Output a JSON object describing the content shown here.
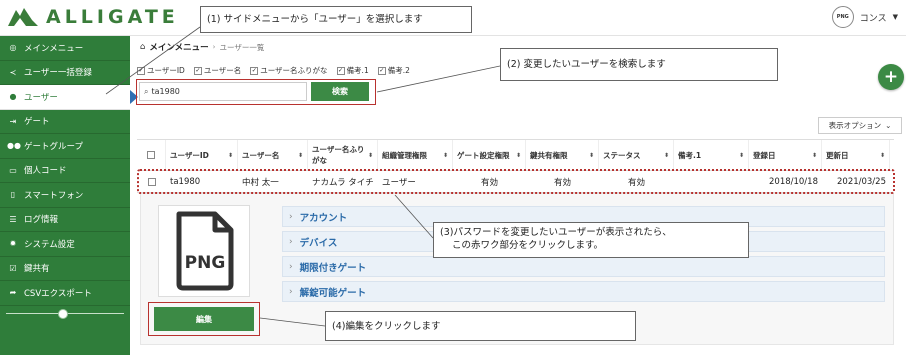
{
  "header": {
    "logo_text": "ALLIGATE",
    "avatar_text": "PNG",
    "user_name": "コンス",
    "user_caret": "▼"
  },
  "sidebar": {
    "items": [
      {
        "icon": "dashboard-icon",
        "glyph": "◎",
        "label": "メインメニュー"
      },
      {
        "icon": "share-icon",
        "glyph": "≺",
        "label": "ユーザー一括登録"
      },
      {
        "icon": "user-icon",
        "glyph": "●",
        "label": "ユーザー"
      },
      {
        "icon": "sign-in-icon",
        "glyph": "⇥",
        "label": "ゲート"
      },
      {
        "icon": "users-icon",
        "glyph": "●●",
        "label": "ゲートグループ"
      },
      {
        "icon": "card-icon",
        "glyph": "▭",
        "label": "個人コード"
      },
      {
        "icon": "phone-icon",
        "glyph": "▯",
        "label": "スマートフォン"
      },
      {
        "icon": "list-icon",
        "glyph": "☰",
        "label": "ログ情報"
      },
      {
        "icon": "gear-icon",
        "glyph": "✹",
        "label": "システム設定"
      },
      {
        "icon": "check-icon",
        "glyph": "☑",
        "label": "鍵共有"
      },
      {
        "icon": "export-icon",
        "glyph": "➦",
        "label": "CSVエクスポート"
      }
    ],
    "active_index": 2
  },
  "breadcrumb": {
    "home": "メインメニュー",
    "current": "ユーザー一覧"
  },
  "column_toggles": [
    {
      "label": "ユーザーID",
      "checked": true
    },
    {
      "label": "ユーザー名",
      "checked": true
    },
    {
      "label": "ユーザー名ふりがな",
      "checked": true
    },
    {
      "label": "備考.1",
      "checked": true
    },
    {
      "label": "備考.2",
      "checked": true
    }
  ],
  "search": {
    "value": "ta1980",
    "button_label": "検索"
  },
  "add_button": "+",
  "display_options": {
    "label": "表示オプション",
    "chevron": "⌄"
  },
  "table": {
    "headers": [
      "ユーザーID",
      "ユーザー名",
      "ユーザー名ふりがな",
      "組織管理権限",
      "ゲート設定権限",
      "鍵共有権限",
      "ステータス",
      "備考.1",
      "登録日",
      "更新日"
    ],
    "sort_glyph": "⬍",
    "rows": [
      [
        "ta1980",
        "中村 太一",
        "ナカムラ タイチ",
        "ユーザー",
        "有効",
        "有効",
        "有効",
        "",
        "2018/10/18",
        "2021/03/25"
      ]
    ]
  },
  "detail": {
    "file_icon_text": "PNG",
    "sections": [
      "アカウント",
      "デバイス",
      "期限付きゲート",
      "解錠可能ゲート"
    ],
    "chevron": "›",
    "edit_button": "編集"
  },
  "annotations": {
    "step1": "(1) サイドメニューから「ユーザー」を選択します",
    "step2": "(2) 変更したいユーザーを検索します",
    "step3_line1": "(3)パスワードを変更したいユーザーが表示されたら、",
    "step3_line2": "この赤ワク部分をクリックします。",
    "step4": "(4)編集をクリックします"
  },
  "colors": {
    "brand_green": "#2f7d3a",
    "button_green": "#3c8a45",
    "annotation_red": "#b8322f",
    "accordion_text": "#2a6aa8"
  }
}
